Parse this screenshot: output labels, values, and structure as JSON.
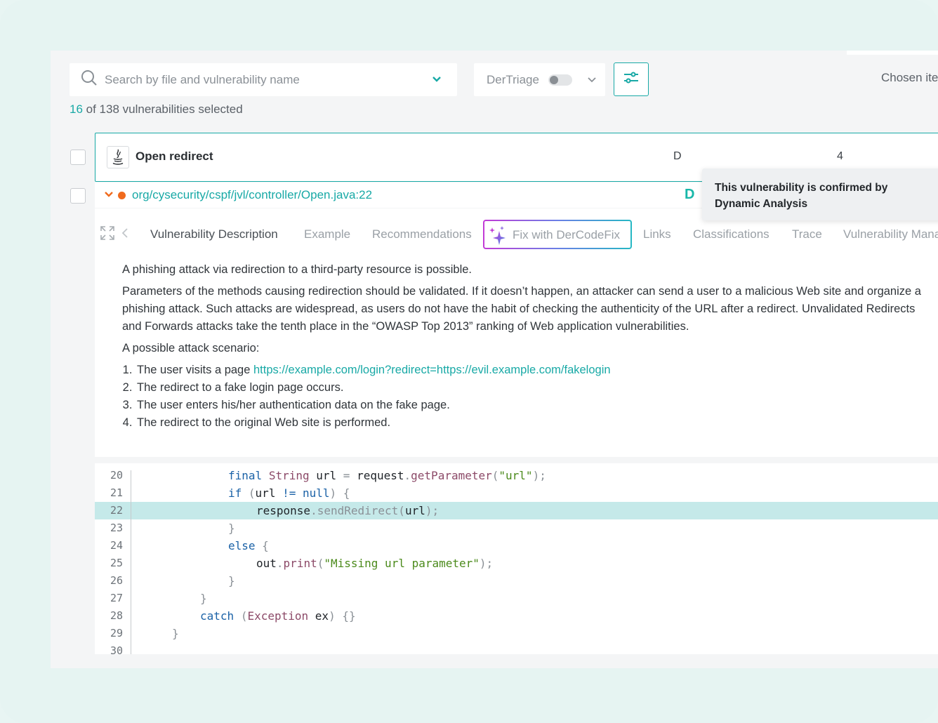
{
  "search": {
    "placeholder": "Search by file and vulnerability name"
  },
  "triage": {
    "label": "DerTriage",
    "enabled": false
  },
  "chosen_label": "Chosen iter",
  "selection": {
    "selected": "16",
    "text": "of  138 vulnerabilities selected"
  },
  "vulnerability": {
    "name": "Open redirect",
    "col_d": "D",
    "col_count": "4",
    "path": "org/cysecurity/cspf/jvl/controller/Open.java:22",
    "badge": "D",
    "tooltip": "This vulnerability is confirmed by Dynamic Analysis"
  },
  "tabs": [
    "Vulnerability Description",
    "Example",
    "Recommendations",
    "Fix with DerCodeFix",
    "Links",
    "Classifications",
    "Trace",
    "Vulnerability Mana"
  ],
  "description": {
    "p1": "A phishing attack via redirection to a third-party resource is possible.",
    "p2": "Parameters of the methods causing redirection should be validated. If it doesn’t happen, an attacker can send a user to a malicious Web site and organize a phishing attack. Such attacks are widespread, as users do not have the habit of checking the authenticity of the URL after a redirect. Unvalidated Redirects and Forwards attacks take the tenth place in the “OWASP Top 2013” ranking of Web application vulnerabilities.",
    "p3": "A possible attack scenario:",
    "step1_text": "The user visits a page ",
    "step1_link": "https://example.com/login?redirect=https://evil.example.com/fakelogin",
    "step2": "The redirect to a fake login page occurs.",
    "step3": "The user enters his/her authentication data on the fake page.",
    "step4": "The redirect to the original Web site is performed."
  },
  "code": {
    "line_numbers": [
      "20",
      "21",
      "22",
      "23",
      "24",
      "25",
      "26",
      "27",
      "28",
      "29",
      "30"
    ],
    "highlight_line": "22",
    "l20": {
      "kw": "final",
      "ty": "String",
      "v": "url",
      "op": "=",
      "obj": "request",
      "fn": "getParameter",
      "str": "\"url\""
    },
    "l21": {
      "kw": "if",
      "v": "url",
      "op": "!=",
      "nul": "null"
    },
    "l22": {
      "obj": "response",
      "fn": "sendRedirect",
      "v": "url"
    },
    "l24": {
      "kw": "else"
    },
    "l25": {
      "obj": "out",
      "fn": "print",
      "str": "\"Missing url parameter\""
    },
    "l28": {
      "kw": "catch",
      "ty": "Exception",
      "v": "ex"
    }
  },
  "colors": {
    "accent": "#18a9a6",
    "status_dot": "#f06a1d",
    "highlight": "#c5e9e9"
  },
  "icons": [
    "search-icon",
    "chevron-down-icon",
    "filter-sliders-icon",
    "java-icon",
    "expand-icon",
    "chevron-left-icon",
    "sparkle-icon"
  ]
}
